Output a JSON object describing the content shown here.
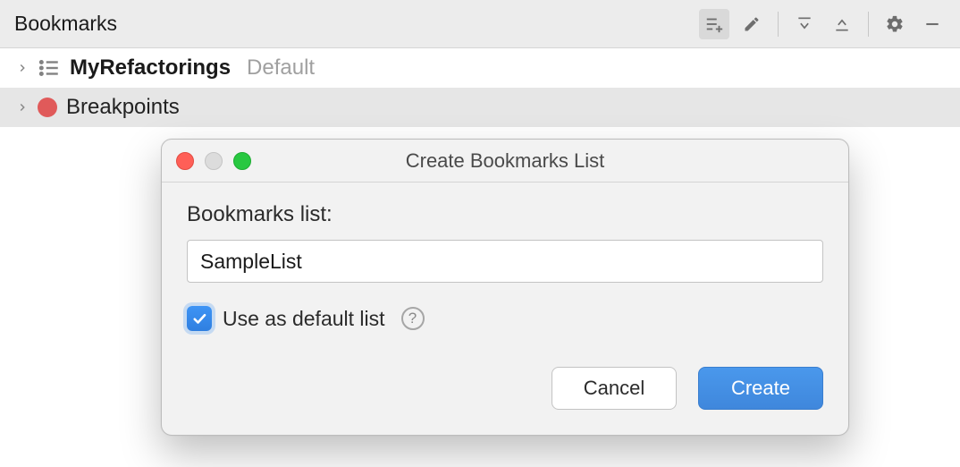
{
  "panel": {
    "title": "Bookmarks",
    "toolbar": {
      "add_list": "add-bookmark-list",
      "edit": "edit",
      "expand_all": "expand-all",
      "collapse_all": "collapse-all",
      "settings": "settings",
      "hide": "hide"
    }
  },
  "tree": {
    "items": [
      {
        "label": "MyRefactorings",
        "suffix": "Default",
        "icon": "bookmark-list",
        "selected": false,
        "bold": true
      },
      {
        "label": "Breakpoints",
        "suffix": "",
        "icon": "breakpoint-dot",
        "selected": true,
        "bold": false
      }
    ]
  },
  "dialog": {
    "title": "Create Bookmarks List",
    "field_label": "Bookmarks list:",
    "name_value": "SampleList",
    "use_default_checked": true,
    "use_default_label": "Use as default list",
    "cancel_label": "Cancel",
    "create_label": "Create"
  }
}
